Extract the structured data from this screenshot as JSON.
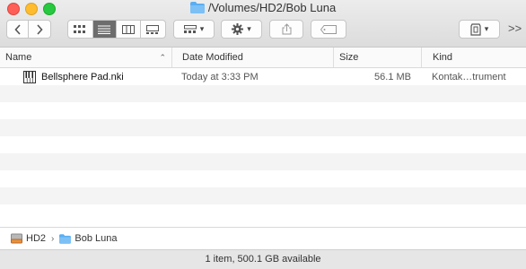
{
  "window": {
    "title": "/Volumes/HD2/Bob Luna"
  },
  "toolbar": {
    "back_icon": "chevron-left",
    "forward_icon": "chevron-right",
    "view_modes": [
      "icon-view",
      "list-view",
      "column-view",
      "gallery-view"
    ],
    "active_view": "list-view",
    "group_icon": "group-by",
    "action_icon": "gear",
    "share_icon": "share",
    "tag_icon": "tag",
    "dropbox_icon": "dropbox",
    "overflow_label": ">>"
  },
  "columns": {
    "name": "Name",
    "date": "Date Modified",
    "size": "Size",
    "kind": "Kind"
  },
  "files": [
    {
      "name": "Bellsphere Pad.nki",
      "date": "Today at 3:33 PM",
      "size": "56.1 MB",
      "kind": "Kontak…trument",
      "icon": "piano-keys-file"
    }
  ],
  "path": {
    "items": [
      {
        "label": "HD2",
        "icon": "drive"
      },
      {
        "label": "Bob Luna",
        "icon": "folder"
      }
    ]
  },
  "status": {
    "text": "1 item, 500.1 GB available"
  },
  "colors": {
    "folder_blue": "#5aaef2",
    "selected_segment": "#6d6d6d"
  }
}
